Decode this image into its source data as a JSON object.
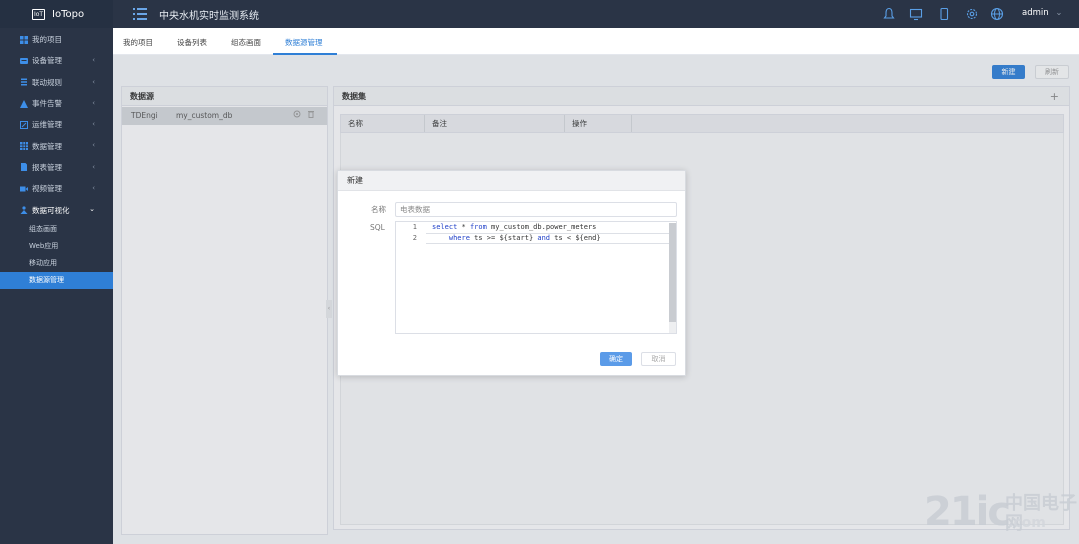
{
  "app": {
    "logo_badge": "IoT",
    "logo_name": "IoTopo",
    "system_title": "中央水机实时监测系统",
    "user": "admin"
  },
  "sidebar": {
    "items": [
      {
        "label": "我的项目",
        "icon": "grid-icon",
        "chevron": ""
      },
      {
        "label": "设备管理",
        "icon": "device-icon",
        "chevron": "‹"
      },
      {
        "label": "联动规则",
        "icon": "rules-icon",
        "chevron": "‹"
      },
      {
        "label": "事件告警",
        "icon": "warning-icon",
        "chevron": "‹"
      },
      {
        "label": "运维管理",
        "icon": "edit-icon",
        "chevron": "‹"
      },
      {
        "label": "数据管理",
        "icon": "data-icon",
        "chevron": "‹"
      },
      {
        "label": "报表管理",
        "icon": "report-icon",
        "chevron": "‹"
      },
      {
        "label": "视频管理",
        "icon": "video-icon",
        "chevron": "‹"
      },
      {
        "label": "数据可视化",
        "icon": "visual-icon",
        "chevron": "⌄"
      }
    ],
    "subitems": [
      {
        "label": "组态画面"
      },
      {
        "label": "Web应用"
      },
      {
        "label": "移动应用"
      },
      {
        "label": "数据源管理"
      }
    ]
  },
  "tabs": [
    {
      "label": "我的项目"
    },
    {
      "label": "设备列表"
    },
    {
      "label": "组态画面"
    },
    {
      "label": "数据源管理"
    }
  ],
  "toolbar": {
    "new_label": "新建",
    "refresh_label": "刷新"
  },
  "datasource_panel": {
    "title": "数据源",
    "row": {
      "type": "TDEngi",
      "name": "my_custom_db"
    }
  },
  "dataset_panel": {
    "title": "数据集",
    "plus": "+",
    "columns": [
      "名称",
      "备注",
      "操作"
    ]
  },
  "dialog": {
    "title": "新建",
    "name_label": "名称",
    "name_value": "电表数据",
    "sql_label": "SQL",
    "code_lines": [
      {
        "n": "1",
        "text": "select * from my_custom_db.power_meters"
      },
      {
        "n": "2",
        "text": "    where ts >= ${start} and ts < ${end}"
      }
    ],
    "ok_label": "确定",
    "cancel_label": "取消"
  },
  "watermark": {
    "big": "21ic",
    "cn": "中国电子网",
    "com": ".com"
  },
  "colors": {
    "sidebar_bg": "#2a3446",
    "accent": "#2f7fd6",
    "keyword": "#2040c8"
  }
}
